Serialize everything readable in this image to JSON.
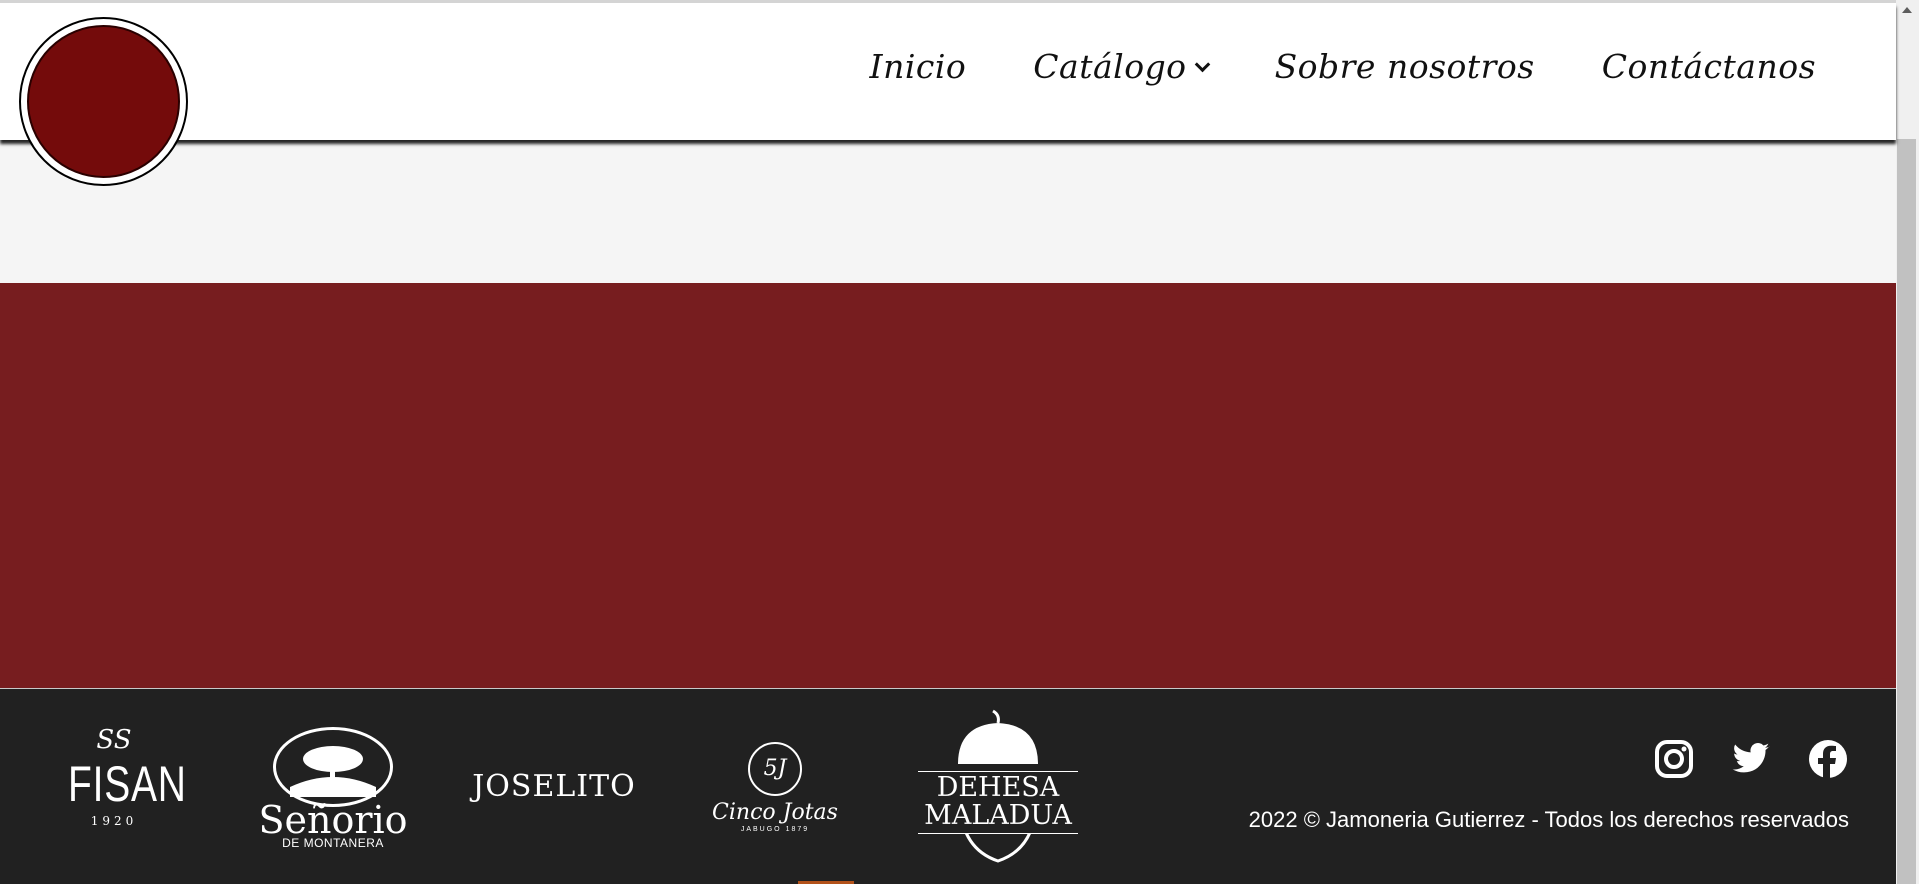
{
  "nav": {
    "items": [
      {
        "label": "Inicio"
      },
      {
        "label": "Catálogo",
        "has_dropdown": true
      },
      {
        "label": "Sobre nosotros"
      },
      {
        "label": "Contáctanos"
      }
    ]
  },
  "colors": {
    "brand_red": "#771d1f",
    "logo_red": "#740b0b",
    "footer_bg": "#212121",
    "light_band": "#f5f5f5"
  },
  "footer": {
    "brands": {
      "fisan": {
        "monogram": "SS",
        "name": "FISAN",
        "year": "1920"
      },
      "senorio": {
        "name": "Señorio",
        "sub": "DE MONTANERA"
      },
      "joselito": {
        "name": "JOSELITO"
      },
      "cinco": {
        "badge": "5J",
        "name": "Cinco Jotas",
        "sub": "JABUGO 1879"
      },
      "dehesa": {
        "line1": "DEHESA",
        "line2": "MALADUA"
      }
    },
    "social": [
      "instagram-icon",
      "twitter-icon",
      "facebook-icon"
    ],
    "copyright": "2022 © Jamoneria Gutierrez - Todos los derechos reservados"
  }
}
